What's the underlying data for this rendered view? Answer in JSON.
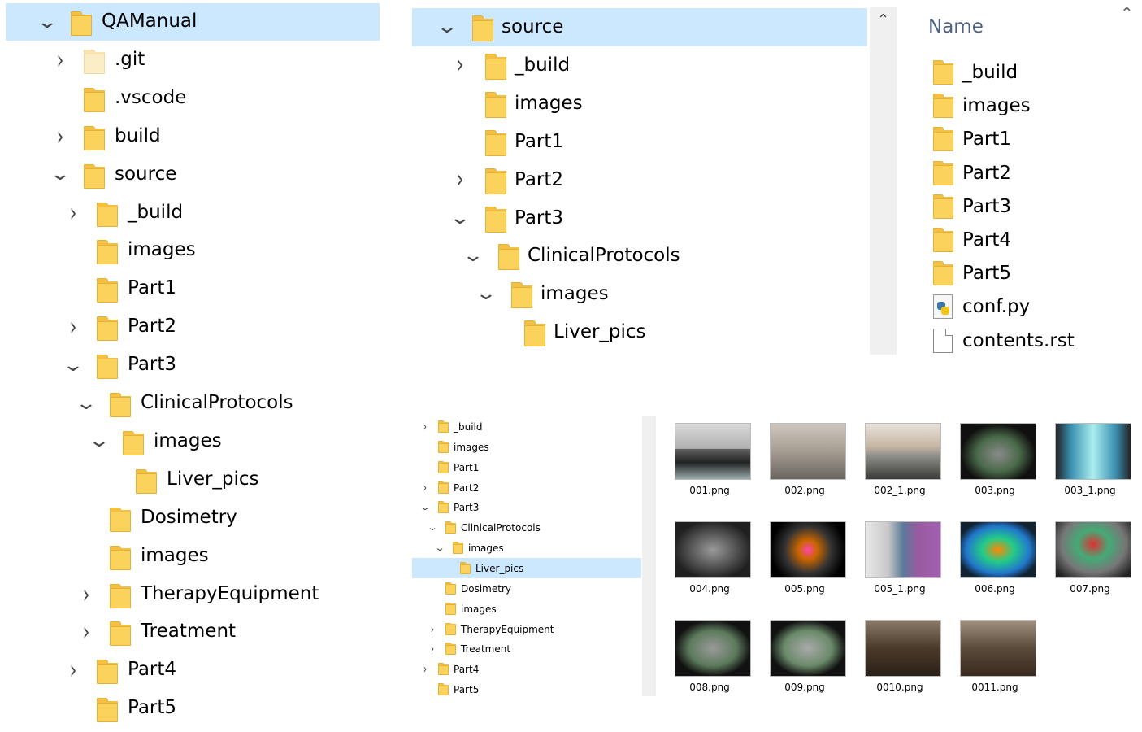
{
  "panel_a": {
    "rows": [
      {
        "label": "QAManual",
        "chevron": "v"
      },
      {
        "label": ".git",
        "chevron": ">"
      },
      {
        "label": ".vscode",
        "chevron": ""
      },
      {
        "label": "build",
        "chevron": ">"
      },
      {
        "label": "source",
        "chevron": "v"
      },
      {
        "label": "_build",
        "chevron": ">"
      },
      {
        "label": "images",
        "chevron": ""
      },
      {
        "label": "Part1",
        "chevron": ""
      },
      {
        "label": "Part2",
        "chevron": ">"
      },
      {
        "label": "Part3",
        "chevron": "v"
      },
      {
        "label": "ClinicalProtocols",
        "chevron": "v"
      },
      {
        "label": "images",
        "chevron": "v"
      },
      {
        "label": "Liver_pics",
        "chevron": ""
      },
      {
        "label": "Dosimetry",
        "chevron": ""
      },
      {
        "label": "images",
        "chevron": ""
      },
      {
        "label": "TherapyEquipment",
        "chevron": ">"
      },
      {
        "label": "Treatment",
        "chevron": ">"
      },
      {
        "label": "Part4",
        "chevron": ">"
      },
      {
        "label": "Part5",
        "chevron": ""
      }
    ]
  },
  "panel_b": {
    "rows": [
      {
        "label": "source",
        "chevron": "v"
      },
      {
        "label": "_build",
        "chevron": ">"
      },
      {
        "label": "images",
        "chevron": ""
      },
      {
        "label": "Part1",
        "chevron": ""
      },
      {
        "label": "Part2",
        "chevron": ">"
      },
      {
        "label": "Part3",
        "chevron": "v"
      },
      {
        "label": "ClinicalProtocols",
        "chevron": "v"
      },
      {
        "label": "images",
        "chevron": "v"
      },
      {
        "label": "Liver_pics",
        "chevron": ""
      }
    ]
  },
  "panel_c": {
    "header": "Name",
    "items": [
      {
        "label": "_build",
        "type": "folder"
      },
      {
        "label": "images",
        "type": "folder"
      },
      {
        "label": "Part1",
        "type": "folder"
      },
      {
        "label": "Part2",
        "type": "folder"
      },
      {
        "label": "Part3",
        "type": "folder"
      },
      {
        "label": "Part4",
        "type": "folder"
      },
      {
        "label": "Part5",
        "type": "folder"
      },
      {
        "label": "conf.py",
        "type": "python"
      },
      {
        "label": "contents.rst",
        "type": "text"
      }
    ]
  },
  "panel_d": {
    "rows": [
      {
        "label": "_build",
        "chevron": ">"
      },
      {
        "label": "images",
        "chevron": ""
      },
      {
        "label": "Part1",
        "chevron": ""
      },
      {
        "label": "Part2",
        "chevron": ">"
      },
      {
        "label": "Part3",
        "chevron": "v"
      },
      {
        "label": "ClinicalProtocols",
        "chevron": "v"
      },
      {
        "label": "images",
        "chevron": "v"
      },
      {
        "label": "Liver_pics",
        "chevron": ""
      },
      {
        "label": "Dosimetry",
        "chevron": ""
      },
      {
        "label": "images",
        "chevron": ""
      },
      {
        "label": "TherapyEquipment",
        "chevron": ">"
      },
      {
        "label": "Treatment",
        "chevron": ">"
      },
      {
        "label": "Part4",
        "chevron": ">"
      },
      {
        "label": "Part5",
        "chevron": ""
      }
    ]
  },
  "panel_e": {
    "thumbnails": [
      {
        "name": "001.png"
      },
      {
        "name": "002.png"
      },
      {
        "name": "002_1.png"
      },
      {
        "name": "003.png"
      },
      {
        "name": "003_1.png"
      },
      {
        "name": "004.png"
      },
      {
        "name": "005.png"
      },
      {
        "name": "005_1.png"
      },
      {
        "name": "006.png"
      },
      {
        "name": "007.png"
      },
      {
        "name": "008.png"
      },
      {
        "name": "009.png"
      },
      {
        "name": "0010.png"
      },
      {
        "name": "0011.png"
      }
    ]
  },
  "colors": {
    "selection": "#cce8ff",
    "folder": "#fbd25b",
    "header_text": "#4d6082"
  }
}
